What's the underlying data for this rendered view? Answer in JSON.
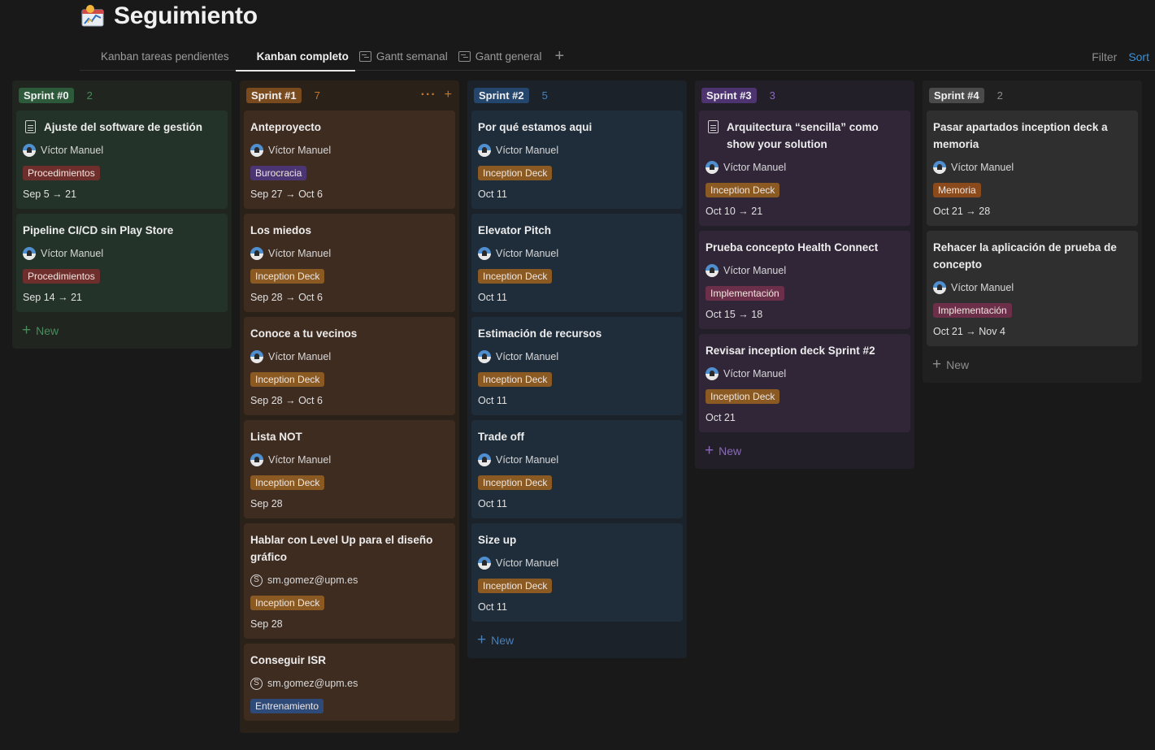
{
  "page": {
    "title": "Seguimiento",
    "icon": "chart-calendar-emoji-icon"
  },
  "tabs": [
    {
      "label": "Kanban tareas pendientes",
      "icon": "board-icon",
      "active": false
    },
    {
      "label": "Kanban completo",
      "icon": "board-icon",
      "active": true
    },
    {
      "label": "Gantt semanal",
      "icon": "timeline-icon",
      "active": false
    },
    {
      "label": "Gantt general",
      "icon": "timeline-icon",
      "active": false
    }
  ],
  "toolbar": {
    "filter_label": "Filter",
    "sort_label": "Sort",
    "add_view_label": "+"
  },
  "new_label": "New",
  "columns": [
    {
      "name": "Sprint #0",
      "count": "2",
      "colors": {
        "bg": "#20261f",
        "card": "#243329",
        "tag": "#2d5a3a",
        "accent": "#4b8a5c"
      },
      "cards": [
        {
          "title": "Ajuste del software de gestión",
          "doc": true,
          "person": "Víctor Manuel",
          "tag": "Procedimientos",
          "tag_class": "tag-proc",
          "date": "Sep 5 → 21"
        },
        {
          "title": "Pipeline CI/CD sin Play Store",
          "person": "Víctor Manuel",
          "tag": "Procedimientos",
          "tag_class": "tag-proc",
          "date": "Sep 14 → 21"
        }
      ]
    },
    {
      "name": "Sprint #1",
      "count": "7",
      "colors": {
        "bg": "#2a2119",
        "card": "#3f2c20",
        "tag": "#7a4a1f",
        "accent": "#c0782e"
      },
      "cards": [
        {
          "title": "Anteproyecto",
          "person": "Víctor Manuel",
          "tag": "Burocracia",
          "tag_class": "tag-buro",
          "date": "Sep 27 → Oct 6"
        },
        {
          "title": "Los miedos",
          "person": "Víctor Manuel",
          "tag": "Inception Deck",
          "tag_class": "tag-incep",
          "date": "Sep 28 → Oct 6"
        },
        {
          "title": "Conoce a tu vecinos",
          "person": "Víctor Manuel",
          "tag": "Inception Deck",
          "tag_class": "tag-incep",
          "date": "Sep 28 → Oct 6"
        },
        {
          "title": "Lista NOT",
          "person": "Víctor Manuel",
          "tag": "Inception Deck",
          "tag_class": "tag-incep",
          "date": "Sep 28"
        },
        {
          "title": "Hablar con Level Up para el diseño gráfico",
          "email": true,
          "person": "sm.gomez@upm.es",
          "tag": "Inception Deck",
          "tag_class": "tag-incep",
          "date": "Sep 28"
        },
        {
          "title": "Conseguir ISR",
          "email": true,
          "person": "sm.gomez@upm.es",
          "tag": "Entrenamiento",
          "tag_class": "tag-entr",
          "date": ""
        }
      ]
    },
    {
      "name": "Sprint #2",
      "count": "5",
      "colors": {
        "bg": "#1c2229",
        "card": "#1f2d3b",
        "tag": "#24466d",
        "accent": "#4a7fb5"
      },
      "cards": [
        {
          "title": "Por qué estamos aqui",
          "person": "Víctor Manuel",
          "tag": "Inception Deck",
          "tag_class": "tag-incep",
          "date": "Oct 11"
        },
        {
          "title": "Elevator Pitch",
          "person": "Víctor Manuel",
          "tag": "Inception Deck",
          "tag_class": "tag-incep",
          "date": "Oct 11"
        },
        {
          "title": "Estimación de recursos",
          "person": "Víctor Manuel",
          "tag": "Inception Deck",
          "tag_class": "tag-incep",
          "date": "Oct 11"
        },
        {
          "title": "Trade off",
          "person": "Víctor Manuel",
          "tag": "Inception Deck",
          "tag_class": "tag-incep",
          "date": "Oct 11"
        },
        {
          "title": "Size up",
          "person": "Víctor Manuel",
          "tag": "Inception Deck",
          "tag_class": "tag-incep",
          "date": "Oct 11"
        }
      ]
    },
    {
      "name": "Sprint #3",
      "count": "3",
      "colors": {
        "bg": "#231f29",
        "card": "#302638",
        "tag": "#4d3470",
        "accent": "#8a6ab8"
      },
      "cards": [
        {
          "title": "Arquitectura “sencilla” como show your solution",
          "doc": true,
          "person": "Víctor Manuel",
          "tag": "Inception Deck",
          "tag_class": "tag-incep",
          "date": "Oct 10 → 21"
        },
        {
          "title": "Prueba concepto Health Connect",
          "person": "Víctor Manuel",
          "tag": "Implementación",
          "tag_class": "tag-impl",
          "date": "Oct 15 → 18"
        },
        {
          "title": "Revisar inception deck Sprint #2",
          "person": "Víctor Manuel",
          "tag": "Inception Deck",
          "tag_class": "tag-incep",
          "date": "Oct 21"
        }
      ]
    },
    {
      "name": "Sprint #4",
      "count": "2",
      "colors": {
        "bg": "#202020",
        "card": "#2f2f2f",
        "tag": "#4a4a4a",
        "accent": "#8d8d8d"
      },
      "cards": [
        {
          "title": "Pasar apartados inception deck a memoria",
          "person": "Víctor Manuel",
          "tag": "Memoria",
          "tag_class": "tag-memo",
          "date": "Oct 21 → 28"
        },
        {
          "title": "Rehacer la aplicación de prueba de concepto",
          "person": "Víctor Manuel",
          "tag": "Implementación",
          "tag_class": "tag-impl",
          "date": "Oct 21 → Nov 4"
        }
      ]
    }
  ]
}
